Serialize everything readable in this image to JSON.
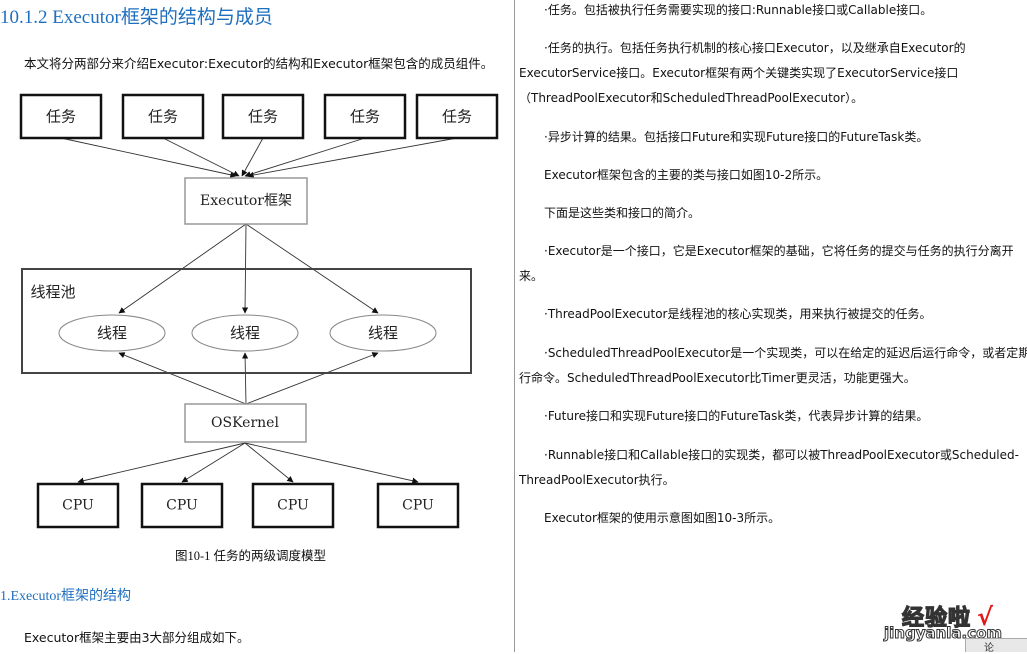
{
  "left_column": {
    "section_title": "10.1.2  Executor框架的结构与成员",
    "intro": "本文将分两部分来介绍Executor:Executor的结构和Executor框架包含的成员组件。",
    "diagram": {
      "tasks": [
        "任务",
        "任务",
        "任务",
        "任务",
        "任务"
      ],
      "executor": "Executor框架",
      "pool_label": "线程池",
      "threads": [
        "线程",
        "线程",
        "线程"
      ],
      "kernel": "OSKernel",
      "cpus": [
        "CPU",
        "CPU",
        "CPU",
        "CPU"
      ]
    },
    "caption": "图10-1  任务的两级调度模型",
    "subsection_title": "1.Executor框架的结构",
    "subsection_text": "Executor框架主要由3大部分组成如下。"
  },
  "right_column": {
    "paragraphs": [
      "·任务。包括被执行任务需要实现的接口:Runnable接口或Callable接口。",
      "·任务的执行。包括任务执行机制的核心接口Executor，以及继承自Executor的",
      "ExecutorService接口。Executor框架有两个关键类实现了ExecutorService接口",
      "（ThreadPoolExecutor和ScheduledThreadPoolExecutor）。",
      "·异步计算的结果。包括接口Future和实现Future接口的FutureTask类。",
      "Executor框架包含的主要的类与接口如图10-2所示。",
      "下面是这些类和接口的简介。",
      "·Executor是一个接口，它是Executor框架的基础，它将任务的提交与任务的执行分离开",
      "来。",
      "·ThreadPoolExecutor是线程池的核心实现类，用来执行被提交的任务。",
      "·ScheduledThreadPoolExecutor是一个实现类，可以在给定的延迟后运行命令，或者定期执",
      "行命令。ScheduledThreadPoolExecutor比Timer更灵活，功能更强大。",
      "·Future接口和实现Future接口的FutureTask类，代表异步计算的结果。",
      "·Runnable接口和Callable接口的实现类，都可以被ThreadPoolExecutor或Scheduled-",
      "ThreadPoolExecutor执行。",
      "Executor框架的使用示意图如图10-3所示。"
    ]
  },
  "watermark": {
    "cn": "经验啦",
    "check": "√",
    "en": "jingyanla.com"
  },
  "corner_tab": "论"
}
